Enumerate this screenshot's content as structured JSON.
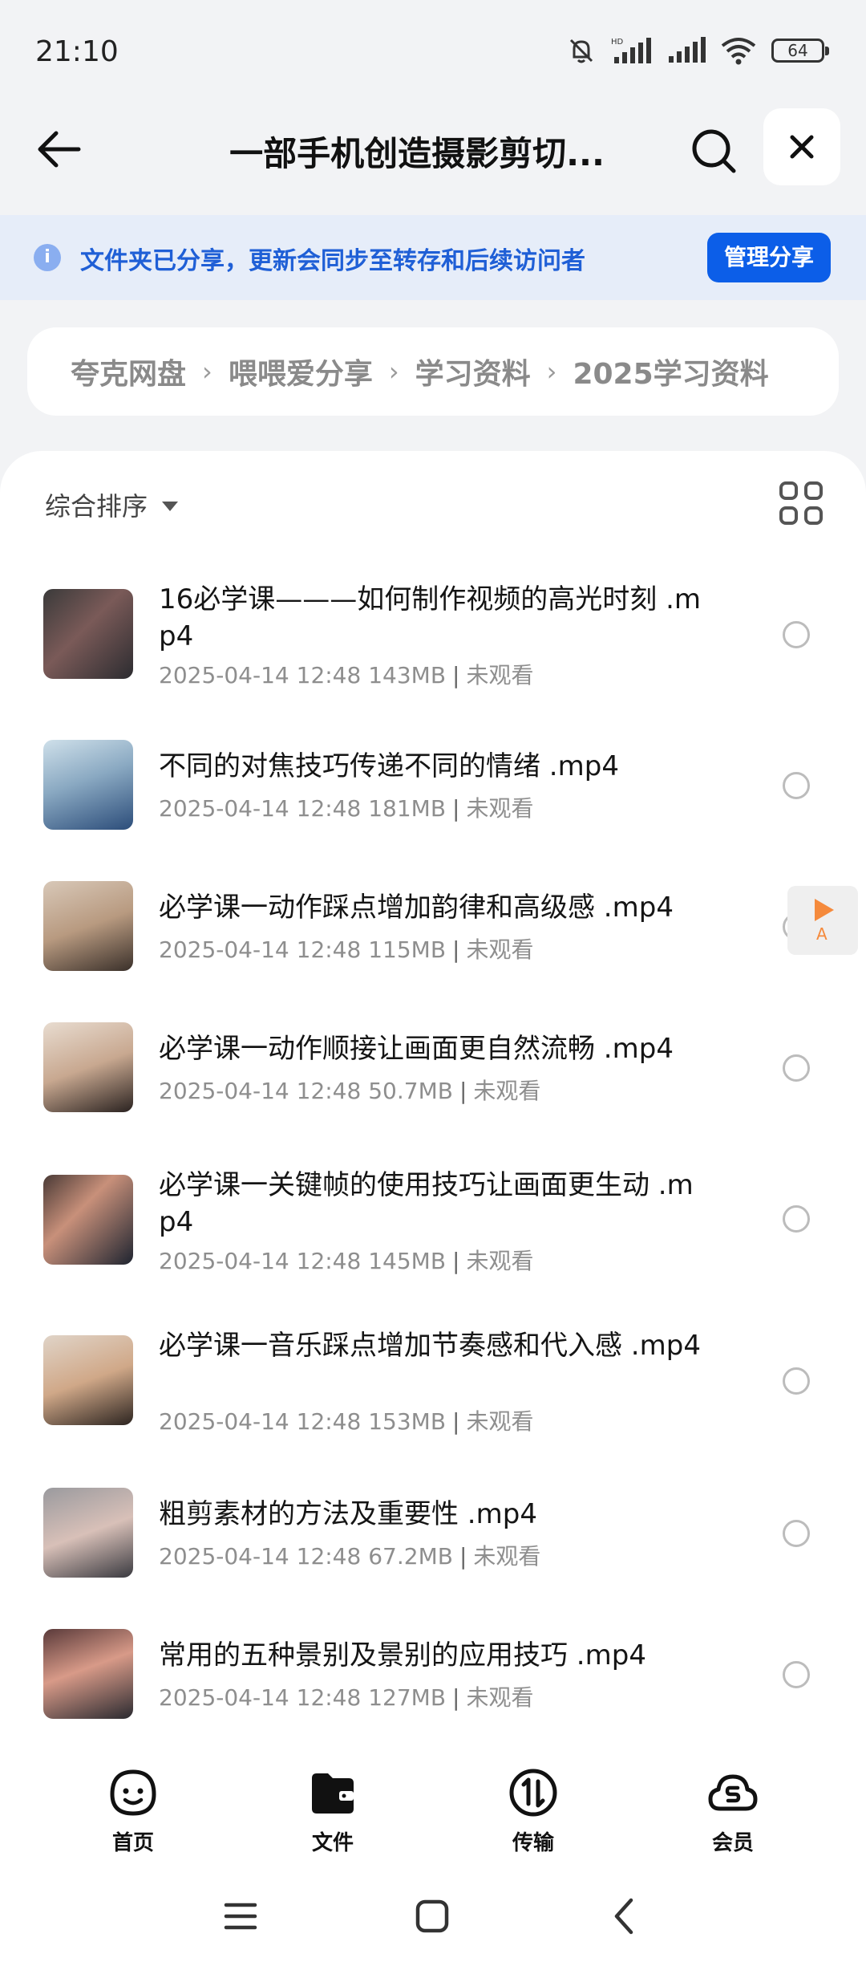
{
  "status_bar": {
    "time": "21:10",
    "battery": "64"
  },
  "header": {
    "title": "一部手机创造摄影剪切..."
  },
  "share_banner": {
    "text": "文件夹已分享，更新会同步至转存和后续访问者",
    "button": "管理分享"
  },
  "breadcrumb": [
    "夸克网盘",
    "喂喂爱分享",
    "学习资料",
    "2025学习资料"
  ],
  "toolbar": {
    "sort_label": "综合排序"
  },
  "files": [
    {
      "name": "16必学课———如何制作视频的高光时刻 .mp4",
      "date": "2025-04-14 12:48",
      "size": "143MB",
      "status": "未观看"
    },
    {
      "name": "不同的对焦技巧传递不同的情绪 .mp4",
      "date": "2025-04-14 12:48",
      "size": "181MB",
      "status": "未观看"
    },
    {
      "name": "必学课一动作踩点增加韵律和高级感 .mp4",
      "date": "2025-04-14 12:48",
      "size": "115MB",
      "status": "未观看"
    },
    {
      "name": "必学课一动作顺接让画面更自然流畅 .mp4",
      "date": "2025-04-14 12:48",
      "size": "50.7MB",
      "status": "未观看"
    },
    {
      "name": "必学课一关键帧的使用技巧让画面更生动 .mp4",
      "date": "2025-04-14 12:48",
      "size": "145MB",
      "status": "未观看"
    },
    {
      "name": "必学课一音乐踩点增加节奏感和代入感 .mp4",
      "date": "2025-04-14 12:48",
      "size": "153MB",
      "status": "未观看"
    },
    {
      "name": "粗剪素材的方法及重要性 .mp4",
      "date": "2025-04-14 12:48",
      "size": "67.2MB",
      "status": "未观看"
    },
    {
      "name": "常用的五种景别及景别的应用技巧 .mp4",
      "date": "2025-04-14 12:48",
      "size": "127MB",
      "status": "未观看"
    }
  ],
  "floating_player": {
    "label": "A"
  },
  "bottom_nav": {
    "home": "首页",
    "files": "文件",
    "transfer": "传输",
    "member": "会员"
  },
  "colors": {
    "accent": "#0c5ee8",
    "banner_bg": "#e6edf9",
    "banner_text": "#1f5fd6"
  }
}
